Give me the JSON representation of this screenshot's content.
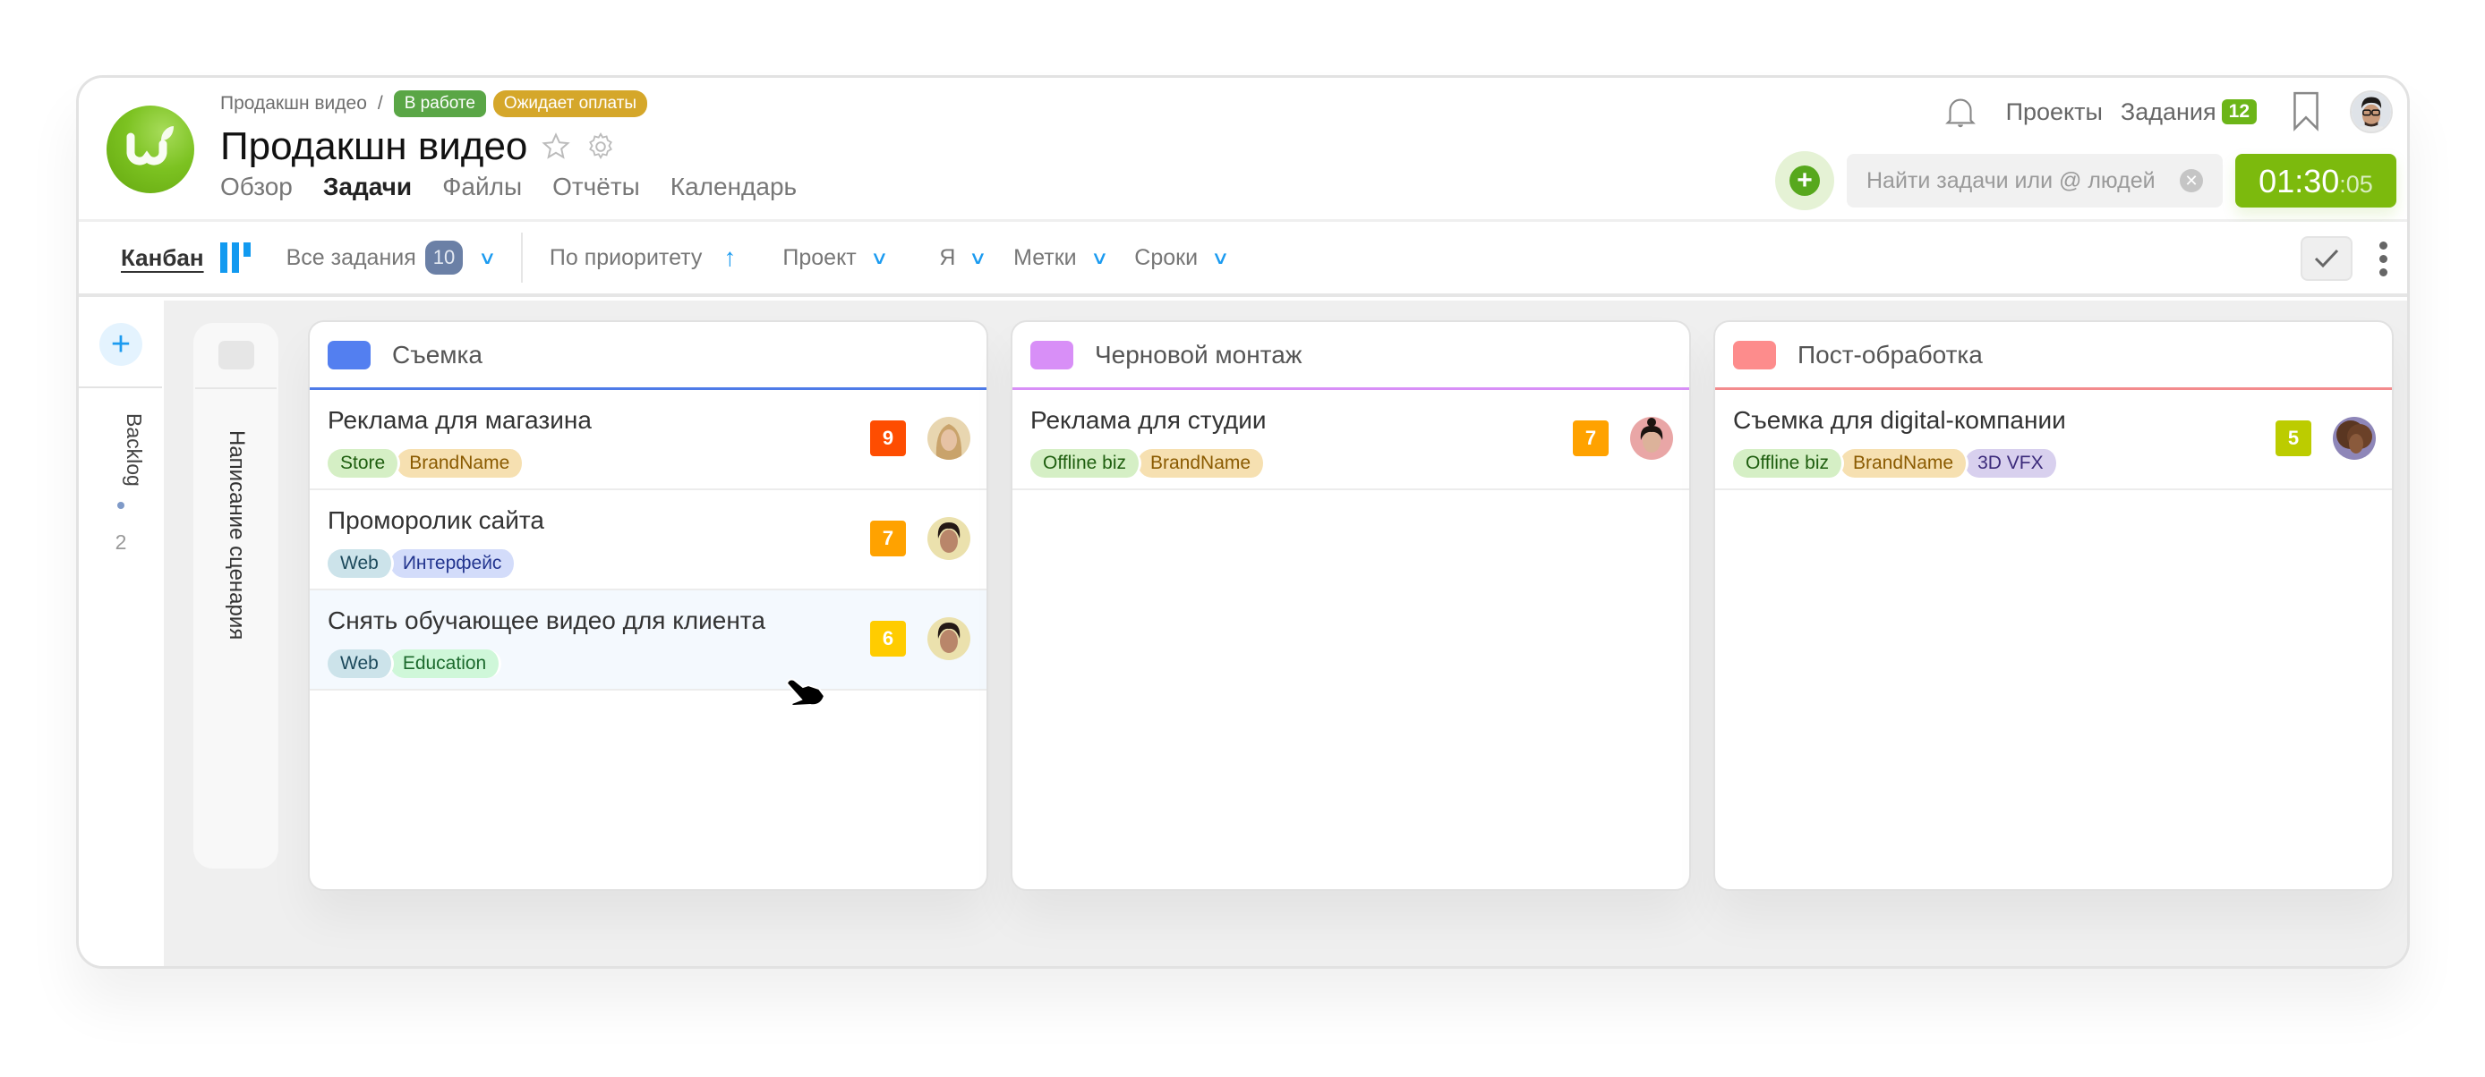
{
  "header": {
    "breadcrumb_parent": "Продакшн видео",
    "breadcrumb_separator": "/",
    "status_badges": [
      {
        "label": "В работе",
        "color": "#5aa646"
      },
      {
        "label": "Ожидает оплаты",
        "color": "#d5a72a"
      }
    ],
    "title": "Продакшн видео",
    "tabs": [
      {
        "label": "Обзор",
        "active": false
      },
      {
        "label": "Задачи",
        "active": true
      },
      {
        "label": "Файлы",
        "active": false
      },
      {
        "label": "Отчёты",
        "active": false
      },
      {
        "label": "Календарь",
        "active": false
      }
    ],
    "icons": {
      "logo": "wrike-logo",
      "star": "star-icon",
      "settings": "gear-icon"
    }
  },
  "topnav": {
    "projects_label": "Проекты",
    "tasks_label": "Задания",
    "tasks_count": "12",
    "search_placeholder": "Найти задачи или @ людей",
    "search_value": "",
    "timer_main": "01:30",
    "timer_seconds": ":05",
    "accent_color": "#7cba0d"
  },
  "toolbar": {
    "view_label": "Канбан",
    "filter_all_tasks": "Все задания",
    "all_tasks_count": "10",
    "sort_label": "По приоритету",
    "filter_project": "Проект",
    "filter_me": "Я",
    "filter_tags": "Метки",
    "filter_dates": "Сроки"
  },
  "board": {
    "backlog": {
      "label": "Backlog",
      "count": "2"
    },
    "collapsed_column": {
      "label": "Написание сценария"
    },
    "columns": [
      {
        "title": "Съемка",
        "color": "#537ff0",
        "line_color": "#4e7be8",
        "tasks": [
          {
            "title": "Реклама для магазина",
            "priority": "9",
            "priority_color": "#fe4d01",
            "tags": [
              {
                "label": "Store",
                "bg": "#d5efc5",
                "fg": "#1e5e0f"
              },
              {
                "label": "BrandName",
                "bg": "#f6e0b1",
                "fg": "#8a5a00"
              }
            ],
            "avatar": "woman-blonde"
          },
          {
            "title": "Проморолик сайта",
            "priority": "7",
            "priority_color": "#ffa200",
            "tags": [
              {
                "label": "Web",
                "bg": "#cce3ea",
                "fg": "#1d4a5c"
              },
              {
                "label": "Интерфейс",
                "bg": "#d3dcfa",
                "fg": "#23358f"
              }
            ],
            "avatar": "man-dark-hair"
          },
          {
            "title": "Снять обучающее видео для клиента",
            "priority": "6",
            "priority_color": "#ffcc00",
            "tags": [
              {
                "label": "Web",
                "bg": "#cce3ea",
                "fg": "#1d4a5c"
              },
              {
                "label": "Education",
                "bg": "#cff7d9",
                "fg": "#1c6a2d"
              }
            ],
            "avatar": "man-dark-hair"
          }
        ]
      },
      {
        "title": "Черновой монтаж",
        "color": "#d88ff7",
        "line_color": "#d88ff7",
        "tasks": [
          {
            "title": "Реклама для студии",
            "priority": "7",
            "priority_color": "#ffa200",
            "tags": [
              {
                "label": "Offline biz",
                "bg": "#d5efc5",
                "fg": "#1e5e0f"
              },
              {
                "label": "BrandName",
                "bg": "#f6e0b1",
                "fg": "#8a5a00"
              }
            ],
            "avatar": "woman-bun"
          }
        ]
      },
      {
        "title": "Пост-обработка",
        "color": "#fd8c8c",
        "line_color": "#f38b8d",
        "tasks": [
          {
            "title": "Съемка для digital-компании",
            "priority": "5",
            "priority_color": "#bccc00",
            "tags": [
              {
                "label": "Offline biz",
                "bg": "#d5efc5",
                "fg": "#1e5e0f"
              },
              {
                "label": "BrandName",
                "bg": "#f6e0b1",
                "fg": "#8a5a00"
              },
              {
                "label": "3D VFX",
                "bg": "#d8d0ee",
                "fg": "#3b2a7a"
              }
            ],
            "avatar": "woman-curly"
          }
        ]
      }
    ]
  }
}
